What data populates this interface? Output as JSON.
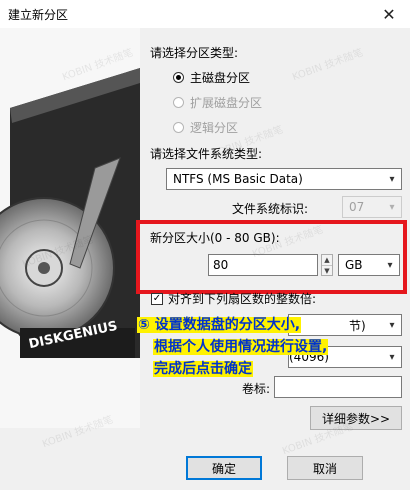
{
  "window": {
    "title": "建立新分区",
    "close_glyph": "✕"
  },
  "brand_text": "DISKGENIUS",
  "watermark": "KOBIN 技术随笔",
  "partition_type": {
    "label": "请选择分区类型:",
    "options": [
      {
        "label": "主磁盘分区",
        "selected": true,
        "enabled": true
      },
      {
        "label": "扩展磁盘分区",
        "selected": false,
        "enabled": false
      },
      {
        "label": "逻辑分区",
        "selected": false,
        "enabled": false
      }
    ]
  },
  "filesystem": {
    "label": "请选择文件系统类型:",
    "value": "NTFS (MS Basic Data)",
    "id_label": "文件系统标识:",
    "id_value": "07"
  },
  "size": {
    "label": "新分区大小(0 - 80 GB):",
    "value": "80",
    "unit": "GB"
  },
  "align": {
    "label": "对齐到下列扇区数的整数倍:",
    "checked": true,
    "glyph": "✓"
  },
  "hidden_rows": {
    "row1_suffix": "节)",
    "row2_suffix": "(4096)"
  },
  "volume": {
    "label": "卷标:",
    "value": ""
  },
  "advanced_button": "详细参数>>",
  "ok_button": "确定",
  "cancel_button": "取消",
  "callout": {
    "line1": "⑤ 设置数据盘的分区大小,",
    "line2": "根据个人使用情况进行设置,",
    "line3": "完成后点击确定"
  },
  "colors": {
    "highlight_box": "#e5171d",
    "callout_text": "#0033cc",
    "callout_bg": "#fff200"
  }
}
